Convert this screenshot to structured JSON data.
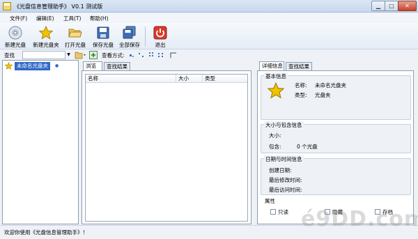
{
  "window": {
    "title": "《光盘信息管理助手》 V0.1 测试版"
  },
  "menu": [
    "文件(F)",
    "编辑(E)",
    "工具(T)",
    "帮助(H)"
  ],
  "toolbar": {
    "new_disc": "新建光盘",
    "new_folder": "新建光盘夹",
    "open_disc": "打开光盘",
    "save_disc": "保存光盘",
    "save_all": "全部保存",
    "exit": "退出"
  },
  "search": {
    "label": "查找",
    "value": ""
  },
  "view_mode_label": "查看方式:",
  "tree": {
    "root_label": "未命名光盘夹"
  },
  "middle": {
    "tabs": [
      "浏览",
      "查找结果"
    ],
    "columns": [
      "名称",
      "大小",
      "类型"
    ]
  },
  "right": {
    "tabs": [
      "详细信息",
      "查找结果"
    ],
    "basic": {
      "title": "基本信息",
      "name_label": "名称:",
      "name_value": "未命名光盘夹",
      "type_label": "类型:",
      "type_value": "光盘夹"
    },
    "size": {
      "title": "大小与包含信息",
      "size_label": "大小:",
      "contains_label": "包含:",
      "contains_value": "0 个光盘"
    },
    "date": {
      "title": "日期与时间信息",
      "created_label": "创建日期:",
      "modified_label": "最后修改时间:",
      "accessed_label": "最后访问时间:"
    },
    "attrs": {
      "title": "属性",
      "readonly": "只读",
      "hidden": "隐藏",
      "archive": "存档"
    }
  },
  "status": "欢迎你使用《光盘信息管理助手》！",
  "watermark": "é9DD.com",
  "colors": {
    "selection": "#3169c6",
    "star": "#f2c200",
    "exit": "#d83a2a"
  }
}
